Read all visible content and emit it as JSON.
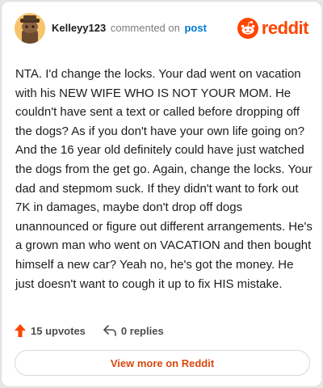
{
  "header": {
    "username": "Kelleyy123",
    "commented_text": "commented on",
    "post_link": "post",
    "brand": "reddit"
  },
  "comment": {
    "text": "NTA. I'd change the locks. Your dad went on vacation with his NEW WIFE WHO IS NOT YOUR MOM. He couldn't have sent a text or called before dropping off the dogs? As if you don't have your own life going on? And the 16 year old definitely could have just watched the dogs from the get go. Again, change the locks. Your dad and stepmom suck. If they didn't want to fork out 7K in damages, maybe don't drop off dogs unannounced or figure out different arrangements. He's a grown man who went on VACATION and then bought himself a new car? Yeah no, he's got the money. He just doesn't want to cough it up to fix HIS mistake."
  },
  "footer": {
    "upvotes": "15 upvotes",
    "replies": "0 replies",
    "view_more": "View more on Reddit"
  },
  "colors": {
    "brand": "#ff4500",
    "link": "#0079d3",
    "view_more": "#d9480f"
  },
  "icons": {
    "upvote": "upvote-arrow-icon",
    "reply": "reply-arrow-icon",
    "logo": "reddit-snoo-icon",
    "avatar": "snoo-avatar-icon"
  }
}
